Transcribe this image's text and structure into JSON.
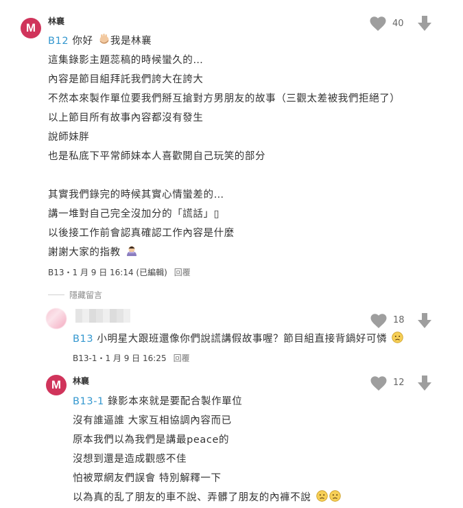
{
  "comment1": {
    "avatar_letter": "M",
    "author": "林襄",
    "likes": "40",
    "floor": "B12",
    "lines": [
      "你好",
      "我是林襄",
      "這集錄影主題蕊稿的時候蠻久的…",
      "內容是節目組拜託我們誇大在誇大",
      "不然本來製作單位要我們掰互搶對方男朋友的故事（三觀太差被我們拒絕了）",
      "以上節目所有故事內容都沒有發生",
      "說師妹胖",
      "也是私底下平常師妹本人喜歡開自己玩笑的部分",
      "其實我們錄完的時候其實心情蠻差的…",
      "講一堆對自己完全沒加分的「謊話」▯",
      "以後接工作前會認真確認工作內容是什麼",
      "謝謝大家的指教"
    ],
    "meta": "B13・1 月 9 日 16:14 (已編輯)",
    "reply_label": "回覆"
  },
  "hidden_label": "隱藏留言",
  "comment2": {
    "likes": "18",
    "floor": "B13",
    "text": "小明星大跟班還像你們說謊講假故事喔？節目組直接背鍋好可憐",
    "meta": "B13-1・1 月 9 日 16:25",
    "reply_label": "回覆"
  },
  "comment3": {
    "avatar_letter": "M",
    "author": "林襄",
    "likes": "12",
    "floor": "B13-1",
    "lines": [
      "錄影本來就是要配合製作單位",
      "沒有誰逼誰 大家互相協調內容而已",
      "原本我們以為我們是講最peace的",
      "沒想到還是造成觀感不佳",
      "怕被眾網友們誤會 特別解釋一下",
      "以為真的乱了朋友的車不說、弄髒了朋友的內褲不說"
    ]
  },
  "icons": {
    "heart": "heart-icon",
    "thumb_down": "thumb-down-icon",
    "wave_hand": "waving-hand-icon",
    "bow": "bowing-person-icon",
    "sad_face": "sad-face-icon"
  },
  "colors": {
    "avatar": "#d0345b",
    "floor_link": "#3397cf",
    "icon_gray": "#9e9e9e"
  }
}
